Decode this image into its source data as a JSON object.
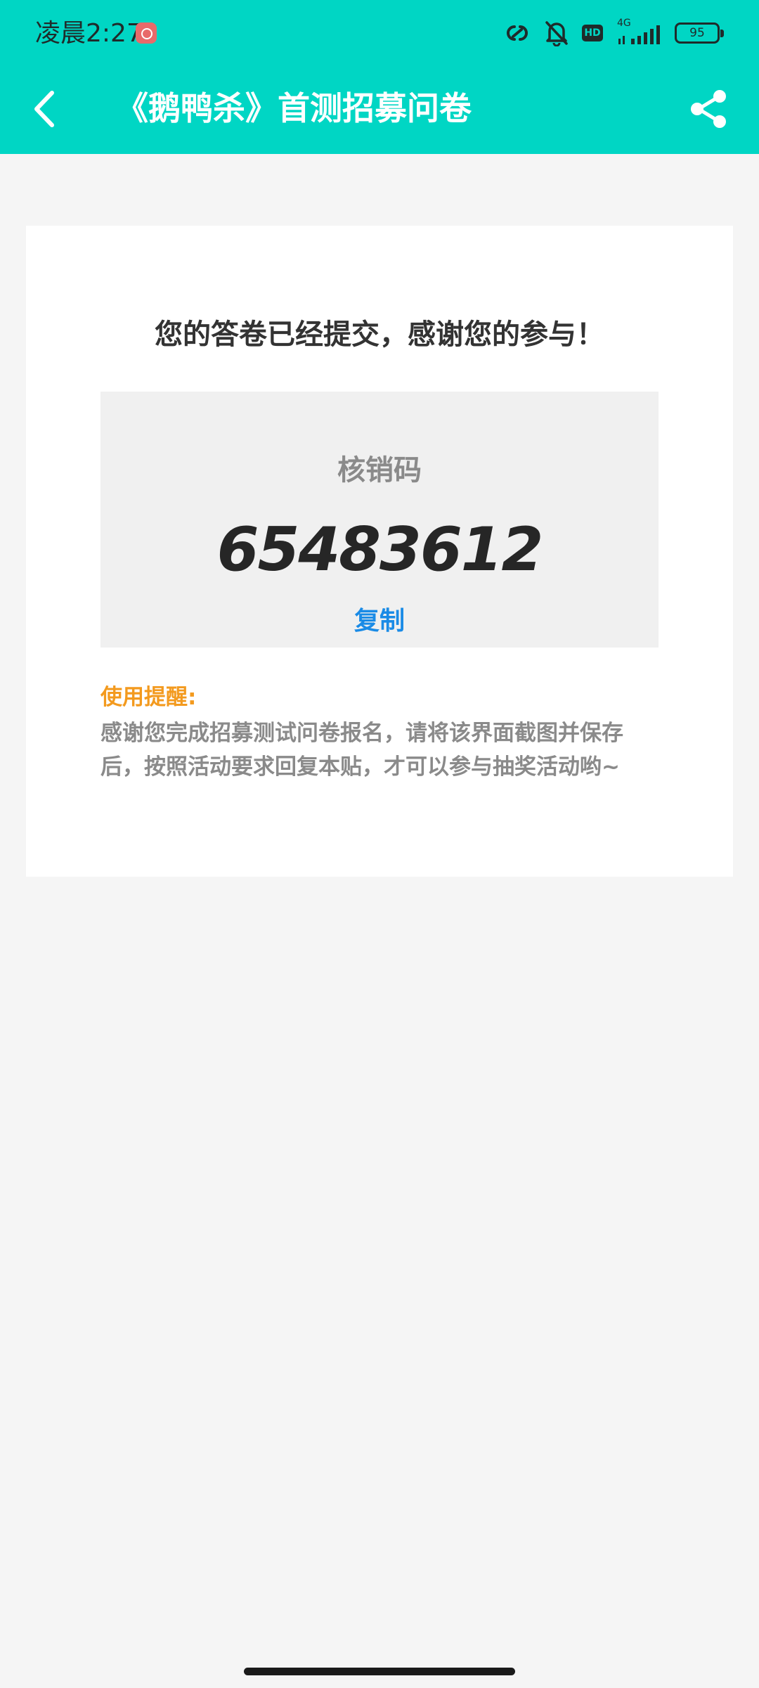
{
  "status_bar": {
    "time": "凌晨2:27",
    "network_type": "4G",
    "hd_badge": "HD",
    "battery_level": "95"
  },
  "nav": {
    "title": "《鹅鸭杀》首测招募问卷"
  },
  "result": {
    "message": "您的答卷已经提交，感谢您的参与！",
    "code_label": "核销码",
    "code_value": "65483612",
    "copy_label": "复制"
  },
  "tips": {
    "title": "使用提醒:",
    "body": "感谢您完成招募测试问卷报名，请将该界面截图并保存后，按照活动要求回复本贴，才可以参与抽奖活动哟~"
  },
  "colors": {
    "header_bg": "#00d6c4",
    "page_bg": "#f5f5f5",
    "copy_link": "#1a8be6",
    "tips_title": "#f39a1e"
  },
  "icons": [
    "back-arrow-icon",
    "share-icon",
    "link-icon",
    "mute-bell-icon",
    "signal-icon",
    "battery-icon",
    "app-notification-icon"
  ]
}
